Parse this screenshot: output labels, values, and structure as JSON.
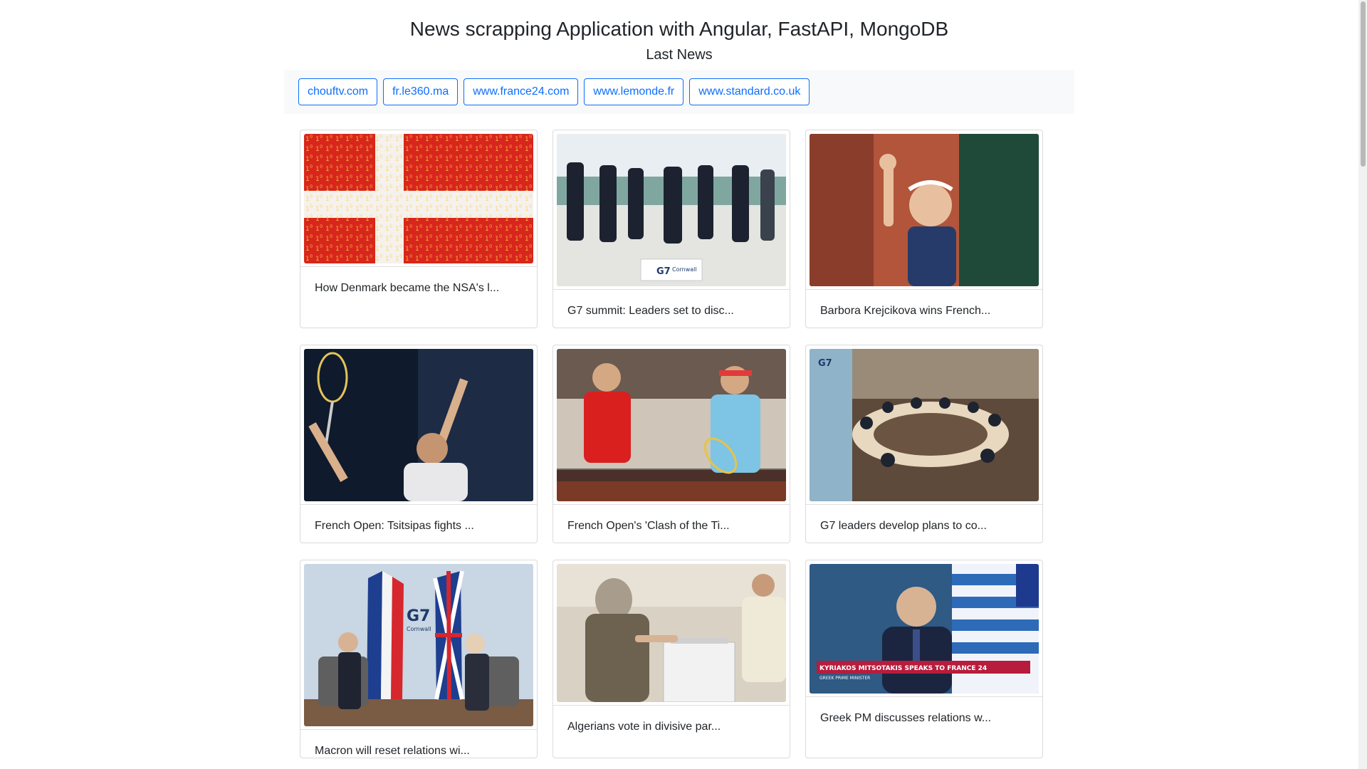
{
  "header": {
    "title": "News scrapping Application with Angular, FastAPI, MongoDB",
    "subtitle": "Last News"
  },
  "sources": [
    {
      "label": "chouftv.com"
    },
    {
      "label": "fr.le360.ma"
    },
    {
      "label": "www.france24.com"
    },
    {
      "label": "www.lemonde.fr"
    },
    {
      "label": "www.standard.co.uk"
    }
  ],
  "articles": [
    {
      "headline": "How Denmark became the NSA's l...",
      "image": "danish-flag-binary-image"
    },
    {
      "headline": "G7 summit: Leaders set to disc...",
      "image": "g7-leaders-photo"
    },
    {
      "headline": "Barbora Krejcikova wins French...",
      "image": "krejcikova-celebration-photo"
    },
    {
      "headline": "French Open: Tsitsipas fights ...",
      "image": "tsitsipas-celebration-photo"
    },
    {
      "headline": "French Open's 'Clash of the Ti...",
      "image": "djokovic-nadal-photo"
    },
    {
      "headline": "G7 leaders develop plans to co...",
      "image": "g7-round-table-photo"
    },
    {
      "headline": "Macron will reset relations wi...",
      "image": "macron-johnson-photo"
    },
    {
      "headline": "Algerians vote in divisive par...",
      "image": "algeria-vote-photo"
    },
    {
      "headline": "Greek PM discusses relations w...",
      "image": "mitsotakis-interview-photo",
      "caption": "KYRIAKOS MITSOTAKIS SPEAKS TO FRANCE 24",
      "subcaption": "GREEK PRIME MINISTER"
    }
  ],
  "g7_sign_text": "G7",
  "g7_sign_sub": "Cornwall"
}
